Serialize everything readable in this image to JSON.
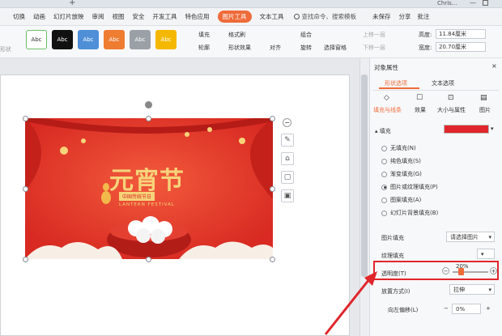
{
  "app": {
    "title_right": "Chris..."
  },
  "menu": {
    "items": [
      "切换",
      "动画",
      "幻灯片放映",
      "审阅",
      "视图",
      "安全",
      "开发工具",
      "特色应用",
      "图片工具",
      "文本工具"
    ],
    "active_index": 8,
    "search": "查找命令、搜索模板",
    "sync": "未保存",
    "share": "分享",
    "comment": "批注"
  },
  "toolbar": {
    "swatch_text": "Abc",
    "swatch_colors": [
      "#ffffff",
      "#111111",
      "#4e8fd8",
      "#ee7c31",
      "#9aa0a6",
      "#f5b800"
    ],
    "fill": "填充",
    "outline": "轮廓",
    "format_brush": "格式刷",
    "shape_effect": "形状效果",
    "align": "对齐",
    "group": "组合",
    "rotate": "旋转",
    "select_pane": "选择窗格",
    "bring_forward": "上移一层",
    "send_backward": "下移一层",
    "height_label": "高度:",
    "height_value": "11.84厘米",
    "width_label": "宽度:",
    "width_value": "20.70厘米",
    "left_btn": "形状"
  },
  "slide_image": {
    "title": "元宵节",
    "subtitle": "中国传统节日",
    "english": "LANTERN FESTIVAL"
  },
  "pane": {
    "header": "对象属性",
    "tabs": [
      "形状选项",
      "文本选项"
    ],
    "subtabs": [
      "填充与线条",
      "效果",
      "大小与属性",
      "图片"
    ],
    "fill_section": "填充",
    "options": [
      "无填充(N)",
      "纯色填充(S)",
      "渐变填充(G)",
      "图片或纹理填充(P)",
      "图案填充(A)",
      "幻灯片背景填充(B)"
    ],
    "selected_option": 3,
    "picture_fill_label": "图片填充",
    "picture_fill_value": "请选择图片",
    "texture_label": "纹理填充",
    "transparency_label": "透明度(T)",
    "transparency_value": "20%",
    "transparency_level": 0.2,
    "tile_label": "放置方式(I)",
    "tile_value": "拉伸",
    "offset_left_label": "向左偏移(L)",
    "offset_left_value": "0%"
  },
  "colors": {
    "accent": "#ef6b3a",
    "highlight_box": "#e0262b",
    "arrow": "#e0262b",
    "banner": "#e63a2e",
    "gold": "#f6d37a"
  }
}
